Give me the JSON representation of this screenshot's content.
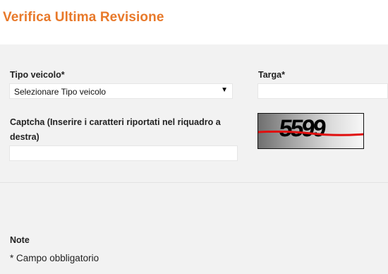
{
  "header": {
    "title": "Verifica Ultima Revisione"
  },
  "form": {
    "tipo_veicolo_label": "Tipo veicolo*",
    "tipo_veicolo_selected": "Selezionare Tipo veicolo",
    "targa_label": "Targa*",
    "targa_value": "",
    "captcha_label_line1": "Captcha (Inserire i caratteri riportati nel riquadro a",
    "captcha_label_line2": "destra)",
    "captcha_value": "",
    "captcha_image_text": "5599"
  },
  "notes": {
    "title": "Note",
    "text": "* Campo obbligatorio"
  },
  "colors": {
    "accent": "#e8792a",
    "captcha_line": "#e01010"
  },
  "icons": {
    "dropdown": "triangle-down"
  }
}
